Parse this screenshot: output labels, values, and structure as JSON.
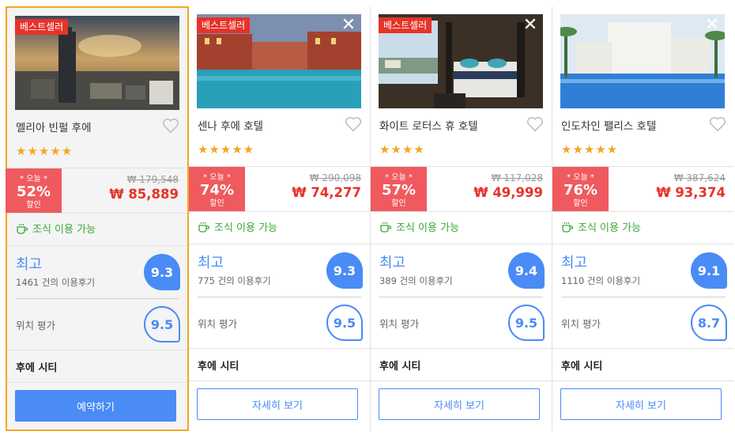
{
  "cards": [
    {
      "badge": "베스트셀러",
      "name": "멜리아 빈펄 후에",
      "stars": "★★★★★",
      "sale_label": "* 오늘 *",
      "discount": "52%",
      "sale_sub": "할인",
      "original_price": "₩ 179,548",
      "price": "₩ 85,889",
      "breakfast": "조식 이용 가능",
      "rating_word": "최고",
      "reviews": "1461 건의 이용후기",
      "score": "9.3",
      "location_label": "위치 평가",
      "location_score": "9.5",
      "city": "후에 시티",
      "button": "예약하기"
    },
    {
      "badge": "베스트셀러",
      "name": "센나 후에 호텔",
      "stars": "★★★★★",
      "sale_label": "* 오늘 *",
      "discount": "74%",
      "sale_sub": "할인",
      "original_price": "₩ 290,098",
      "price": "₩ 74,277",
      "breakfast": "조식 이용 가능",
      "rating_word": "최고",
      "reviews": "775 건의 이용후기",
      "score": "9.3",
      "location_label": "위치 평가",
      "location_score": "9.5",
      "city": "후에 시티",
      "button": "자세히 보기"
    },
    {
      "badge": "베스트셀러",
      "name": "화이트 로터스 휴 호텔",
      "stars": "★★★★",
      "sale_label": "* 오늘 *",
      "discount": "57%",
      "sale_sub": "할인",
      "original_price": "₩ 117,028",
      "price": "₩ 49,999",
      "breakfast": "조식 이용 가능",
      "rating_word": "최고",
      "reviews": "389 건의 이용후기",
      "score": "9.4",
      "location_label": "위치 평가",
      "location_score": "9.5",
      "city": "후에 시티",
      "button": "자세히 보기"
    },
    {
      "badge": "",
      "name": "인도차인 팰리스 호텔",
      "stars": "★★★★★",
      "sale_label": "* 오늘 *",
      "discount": "76%",
      "sale_sub": "할인",
      "original_price": "₩ 387,624",
      "price": "₩ 93,374",
      "breakfast": "조식 이용 가능",
      "rating_word": "최고",
      "reviews": "1110 건의 이용후기",
      "score": "9.1",
      "location_label": "위치 평가",
      "location_score": "8.7",
      "city": "후에 시티",
      "button": "자세히 보기"
    }
  ],
  "icons": {
    "close": "close-icon",
    "heart": "heart-icon",
    "cup": "coffee-cup-icon"
  },
  "colors": {
    "accent_blue": "#4a8bf5",
    "sale_red": "#ef5a5f",
    "price_red": "#e6332a",
    "star_orange": "#f5a623",
    "breakfast_green": "#39a838",
    "selected_border": "#f5a623"
  }
}
